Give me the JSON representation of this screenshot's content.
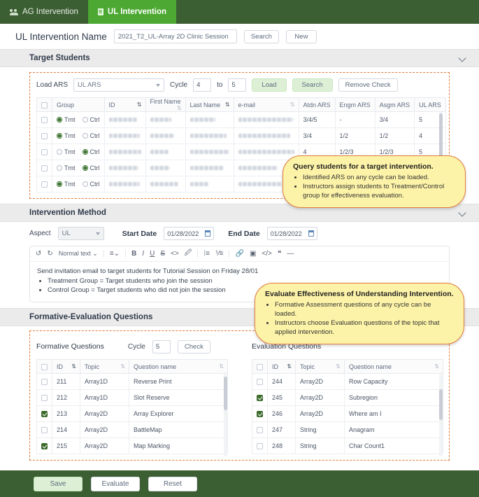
{
  "tabs": [
    {
      "label": "AG Intervention",
      "icon": "people-icon",
      "active": false
    },
    {
      "label": "UL Intervention",
      "icon": "document-icon",
      "active": true
    }
  ],
  "name_bar": {
    "label": "UL Intervention Name",
    "value": "2021_T2_UL-Array 2D Clinic Session",
    "placeholder": "",
    "search_label": "Search",
    "new_label": "New"
  },
  "sections": {
    "target_students": {
      "title": "Target Students"
    },
    "intervention_method": {
      "title": "Intervention Method"
    },
    "formative_evaluation": {
      "title": "Formative-Evaluation Questions"
    }
  },
  "load_ars": {
    "label": "Load ARS",
    "select_value": "UL ARS",
    "cycle_label": "Cycle",
    "cycle_from": "4",
    "to_label": "to",
    "cycle_to": "5",
    "load_label": "Load",
    "search_label": "Search",
    "remove_check_label": "Remove Check"
  },
  "students_table": {
    "columns": [
      "",
      "Group",
      "ID",
      "First Name",
      "Last Name",
      "e-mail",
      "Atdn ARS",
      "Engm ARS",
      "Asgm ARS",
      "UL ARS"
    ],
    "group_options": [
      "Tmt",
      "Ctrl"
    ],
    "rows": [
      {
        "checked": false,
        "group": "Tmt",
        "atdn": "3/4/5",
        "engm": "-",
        "asgm": "3/4",
        "ul": "5"
      },
      {
        "checked": false,
        "group": "Tmt",
        "atdn": "3/4",
        "engm": "1/2",
        "asgm": "1/2",
        "ul": "4"
      },
      {
        "checked": false,
        "group": "Ctrl",
        "atdn": "4",
        "engm": "1/2/3",
        "asgm": "1/2/3",
        "ul": "5"
      },
      {
        "checked": false,
        "group": "Ctrl",
        "atdn": "",
        "engm": "",
        "asgm": "",
        "ul": ""
      },
      {
        "checked": false,
        "group": "Tmt",
        "atdn": "",
        "engm": "",
        "asgm": "",
        "ul": ""
      }
    ]
  },
  "callout_students": {
    "heading": "Query students for a target intervention.",
    "bullets": [
      "Identified ARS on any cycle can be loaded.",
      "Instructors assign students to Treatment/Control group for effectiveness evaluation."
    ]
  },
  "callout_evaluation": {
    "heading": "Evaluate Effectiveness of Understanding Intervention.",
    "bullets": [
      "Formative Assessment questions of any cycle can be loaded.",
      "Instructors choose Evaluation questions of the topic that applied intervention."
    ]
  },
  "method": {
    "aspect_label": "Aspect",
    "aspect_value": "UL",
    "start_label": "Start Date",
    "start_value": "01/28/2022",
    "end_label": "End Date",
    "end_value": "01/28/2022"
  },
  "editor": {
    "undo_icon": "undo-icon",
    "redo_icon": "redo-icon",
    "style_value": "Normal text",
    "tools": [
      "align-icon",
      "bold-icon",
      "italic-icon",
      "underline-icon",
      "strikethrough-icon",
      "code-inline-icon",
      "highlight-icon",
      "bullet-list-icon",
      "numbered-list-icon",
      "link-icon",
      "image-icon",
      "code-block-icon",
      "quote-icon",
      "horizontal-rule-icon"
    ],
    "paragraph": "Send invitation email to target students for Tutorial Session on Friday 28/01",
    "bullets": [
      "Treatment Group = Target students who join the session",
      "Control Group = Target students who did not join the session"
    ]
  },
  "formative": {
    "title": "Formative Questions",
    "cycle_label": "Cycle",
    "cycle_value": "5",
    "check_label": "Check",
    "columns": [
      "",
      "ID",
      "Topic",
      "Question name"
    ],
    "rows": [
      {
        "checked": false,
        "id": "211",
        "topic": "Array1D",
        "question": "Reverse Print"
      },
      {
        "checked": false,
        "id": "212",
        "topic": "Array1D",
        "question": "Slot Reserve"
      },
      {
        "checked": true,
        "id": "213",
        "topic": "Array2D",
        "question": "Array Explorer"
      },
      {
        "checked": false,
        "id": "214",
        "topic": "Array2D",
        "question": "BattleMap"
      },
      {
        "checked": true,
        "id": "215",
        "topic": "Array2D",
        "question": "Map Marking"
      }
    ]
  },
  "evaluation": {
    "title": "Evaluation Questions",
    "columns": [
      "",
      "ID",
      "Topic",
      "Question name"
    ],
    "rows": [
      {
        "checked": false,
        "id": "244",
        "topic": "Array2D",
        "question": "Row Capacity"
      },
      {
        "checked": true,
        "id": "245",
        "topic": "Array2D",
        "question": "Subregion"
      },
      {
        "checked": true,
        "id": "246",
        "topic": "Array2D",
        "question": "Where am I"
      },
      {
        "checked": false,
        "id": "247",
        "topic": "String",
        "question": "Anagram"
      },
      {
        "checked": false,
        "id": "248",
        "topic": "String",
        "question": "Char Count1"
      }
    ]
  },
  "footer": {
    "save_label": "Save",
    "evaluate_label": "Evaluate",
    "reset_label": "Reset"
  },
  "colors": {
    "tab_bar_bg": "#3c5e33",
    "tab_active_bg": "#4ca832",
    "callout_bg": "#fdf3a8",
    "callout_border": "#e07b39",
    "dashed_border": "#e07b39",
    "checkbox_checked": "#3c6b2c",
    "button_green": "#ddf0d6"
  }
}
